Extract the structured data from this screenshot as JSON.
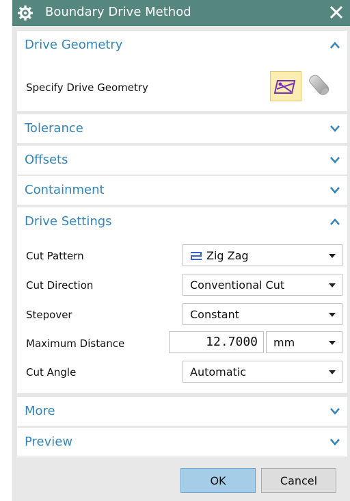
{
  "window": {
    "title": "Boundary Drive Method",
    "title_icon": "gear-icon",
    "close_icon": "close-icon"
  },
  "sections": {
    "drive_geometry": {
      "title": "Drive Geometry",
      "expanded": true,
      "label": "Specify Drive Geometry",
      "icons": [
        "boundary-geometry-icon",
        "tool-holder-icon"
      ]
    },
    "tolerance": {
      "title": "Tolerance",
      "expanded": false
    },
    "offsets": {
      "title": "Offsets",
      "expanded": false
    },
    "containment": {
      "title": "Containment",
      "expanded": false
    },
    "drive_settings": {
      "title": "Drive Settings",
      "expanded": true,
      "cut_pattern": {
        "label": "Cut Pattern",
        "value": "Zig Zag",
        "icon": "zig-zag-icon"
      },
      "cut_direction": {
        "label": "Cut Direction",
        "value": "Conventional Cut"
      },
      "stepover": {
        "label": "Stepover",
        "value": "Constant"
      },
      "maximum_distance": {
        "label": "Maximum Distance",
        "value": "12.7000",
        "unit": "mm"
      },
      "cut_angle": {
        "label": "Cut Angle",
        "value": "Automatic"
      }
    },
    "more": {
      "title": "More",
      "expanded": false
    },
    "preview": {
      "title": "Preview",
      "expanded": false
    }
  },
  "buttons": {
    "ok": "OK",
    "cancel": "Cancel"
  },
  "colors": {
    "titlebar": "#55877f",
    "section_title": "#3385b8",
    "dialog_bg": "#e8e8e8",
    "ok_button": "#a6cde8",
    "highlight": "#fbedb0"
  }
}
